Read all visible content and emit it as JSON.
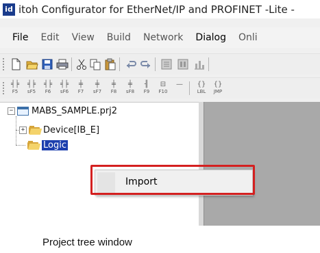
{
  "window": {
    "app_icon_text": "id",
    "title": "itoh Configurator for EtherNet/IP and PROFINET -Lite -"
  },
  "menubar": {
    "items": [
      "File",
      "Edit",
      "View",
      "Build",
      "Network",
      "Dialog",
      "Onli"
    ]
  },
  "toolbar1": {
    "icons": [
      "new-document-icon",
      "open-folder-icon",
      "save-icon",
      "print-icon",
      "cut-icon",
      "copy-icon",
      "paste-icon",
      "undo-icon",
      "redo-icon",
      "build-icon",
      "build-all-icon",
      "chart-icon"
    ]
  },
  "toolbar2": {
    "fkeys": [
      "F5",
      "sF5",
      "F6",
      "sF6",
      "F7",
      "sF7",
      "F8",
      "sF8",
      "F9",
      "F10",
      "",
      "LBL",
      "JMP"
    ]
  },
  "tree": {
    "project": "MABS_SAMPLE.prj2",
    "device": "Device[IB_E]",
    "logic": "Logic",
    "expand_minus": "−",
    "expand_plus": "+"
  },
  "context_menu": {
    "item": "Import"
  },
  "caption": "Project tree window",
  "colors": {
    "selection": "#1c3fae",
    "highlight": "#d42020",
    "workspace": "#a9a9a9"
  }
}
